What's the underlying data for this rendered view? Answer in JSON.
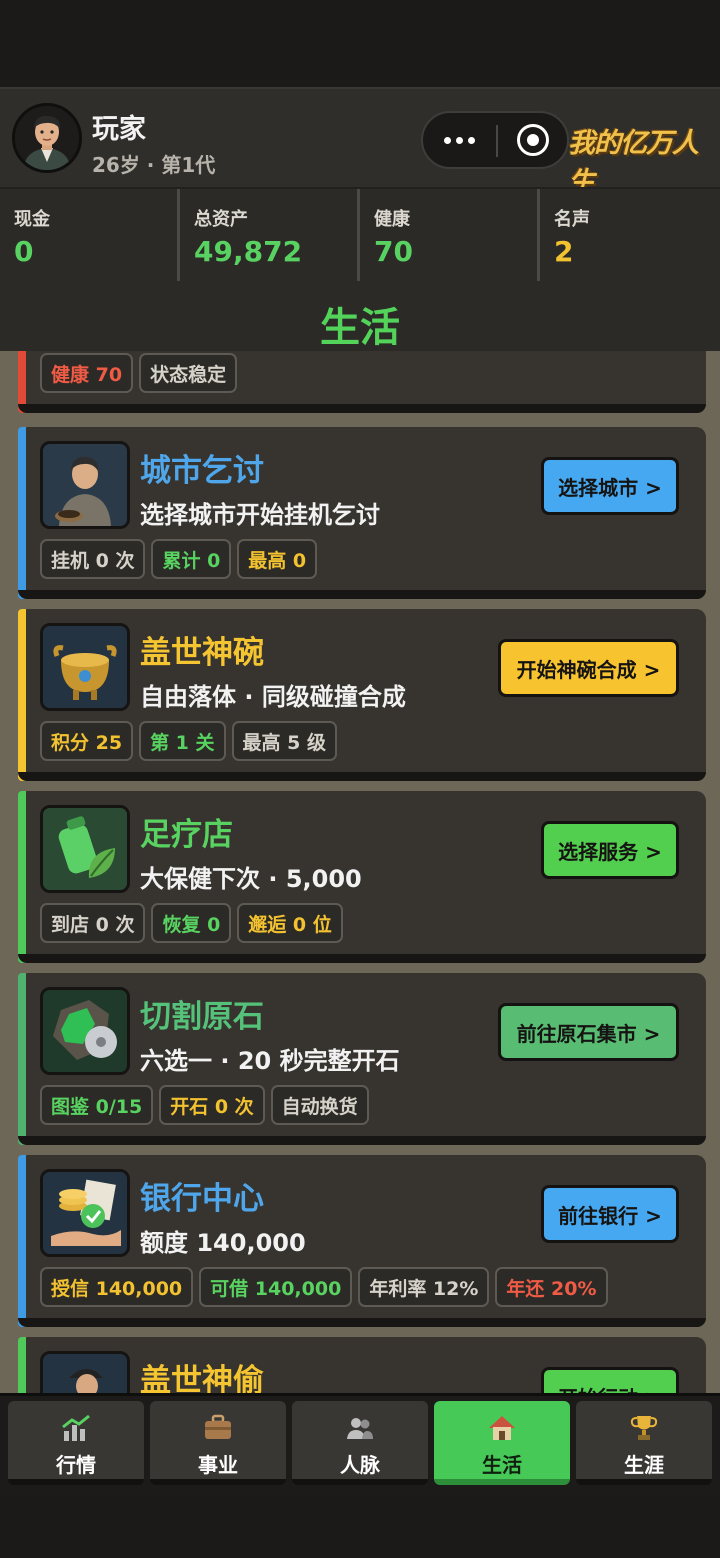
{
  "header": {
    "player_name": "玩家",
    "player_sub": "26岁 · 第1代",
    "logo_text": "我的亿万人生"
  },
  "stats": [
    {
      "label": "现金",
      "value": "0",
      "color": "#58d260"
    },
    {
      "label": "总资产",
      "value": "49,872",
      "color": "#58d260"
    },
    {
      "label": "健康",
      "value": "70",
      "color": "#58d260"
    },
    {
      "label": "名声",
      "value": "2",
      "color": "#f2c230"
    }
  ],
  "page_title": "生活",
  "partial_card": {
    "tags": [
      {
        "text": "健康 70",
        "color": "#ef5b45"
      },
      {
        "text": "状态稳定",
        "color": "#d6d2ca"
      }
    ]
  },
  "cards": [
    {
      "title": "城市乞讨",
      "title_color": "#4fa6ea",
      "accent": "#3f9be4",
      "desc": "选择城市开始挂机乞讨",
      "button": "选择城市 >",
      "button_color": "#45a8f0",
      "icon": "beggar-icon",
      "tags": [
        {
          "text": "挂机 0 次",
          "color": "#d6d2ca"
        },
        {
          "text": "累计 0",
          "color": "#58d260"
        },
        {
          "text": "最高 0",
          "color": "#f2c230"
        }
      ]
    },
    {
      "title": "盖世神碗",
      "title_color": "#f5c431",
      "accent": "#f5c431",
      "desc": "自由落体 · 同级碰撞合成",
      "button": "开始神碗合成 >",
      "button_color": "#f7c42f",
      "icon": "bronze-bowl-icon",
      "tags": [
        {
          "text": "积分 25",
          "color": "#f2c230"
        },
        {
          "text": "第 1 关",
          "color": "#58d260"
        },
        {
          "text": "最高 5 级",
          "color": "#d6d2ca"
        }
      ]
    },
    {
      "title": "足疗店",
      "title_color": "#58d260",
      "accent": "#4fc95a",
      "desc": "大保健下次 · 5,000",
      "button": "选择服务 >",
      "button_color": "#52cf4e",
      "icon": "spa-bottle-icon",
      "tags": [
        {
          "text": "到店 0 次",
          "color": "#d6d2ca"
        },
        {
          "text": "恢复 0",
          "color": "#58d260"
        },
        {
          "text": "邂逅 0 位",
          "color": "#f2c230"
        }
      ]
    },
    {
      "title": "切割原石",
      "title_color": "#55c27a",
      "accent": "#4fb26f",
      "desc": "六选一 · 20 秒完整开石",
      "button": "前往原石集市 >",
      "button_color": "#58bd72",
      "icon": "jade-stone-icon",
      "tags": [
        {
          "text": "图鉴 0/15",
          "color": "#58d260"
        },
        {
          "text": "开石 0 次",
          "color": "#f2c230"
        },
        {
          "text": "自动换货",
          "color": "#d6d2ca"
        }
      ]
    },
    {
      "title": "银行中心",
      "title_color": "#4fa6ea",
      "accent": "#3f9be4",
      "desc": "额度 140,000",
      "button": "前往银行 >",
      "button_color": "#45a8f0",
      "icon": "bank-coins-icon",
      "tags": [
        {
          "text": "授信 140,000",
          "color": "#f2c230"
        },
        {
          "text": "可借 140,000",
          "color": "#58d260"
        },
        {
          "text": "年利率 12%",
          "color": "#d6d2ca"
        },
        {
          "text": "年还 20%",
          "color": "#ef5b45"
        }
      ]
    },
    {
      "title": "盖世神偷",
      "title_color": "#f5c431",
      "accent": "#4fc95a",
      "desc": "",
      "button": "开始行动 >",
      "button_color": "#52cf4e",
      "icon": "thief-icon",
      "tags": []
    }
  ],
  "tabs": [
    {
      "label": "行情",
      "icon": "chart-icon",
      "active": false
    },
    {
      "label": "事业",
      "icon": "briefcase-icon",
      "active": false
    },
    {
      "label": "人脉",
      "icon": "people-icon",
      "active": false
    },
    {
      "label": "生活",
      "icon": "house-icon",
      "active": true
    },
    {
      "label": "生涯",
      "icon": "trophy-icon",
      "active": false
    }
  ]
}
